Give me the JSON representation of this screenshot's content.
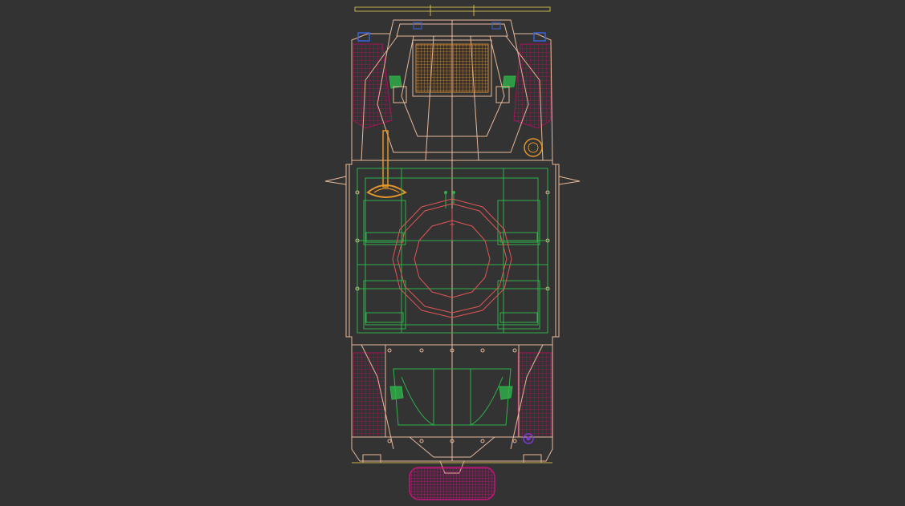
{
  "viewport": {
    "background": "#333333",
    "view": "top wireframe",
    "colors": {
      "hull": "#e8b89a",
      "interior": "#2fb34a",
      "turret_ring": "#e05555",
      "wheels": "#a4145a",
      "spare_wheel": "#b0147a",
      "hatch_handle": "#e3962a",
      "lights": "#3b63d6",
      "bar": "#c9b34a"
    }
  }
}
